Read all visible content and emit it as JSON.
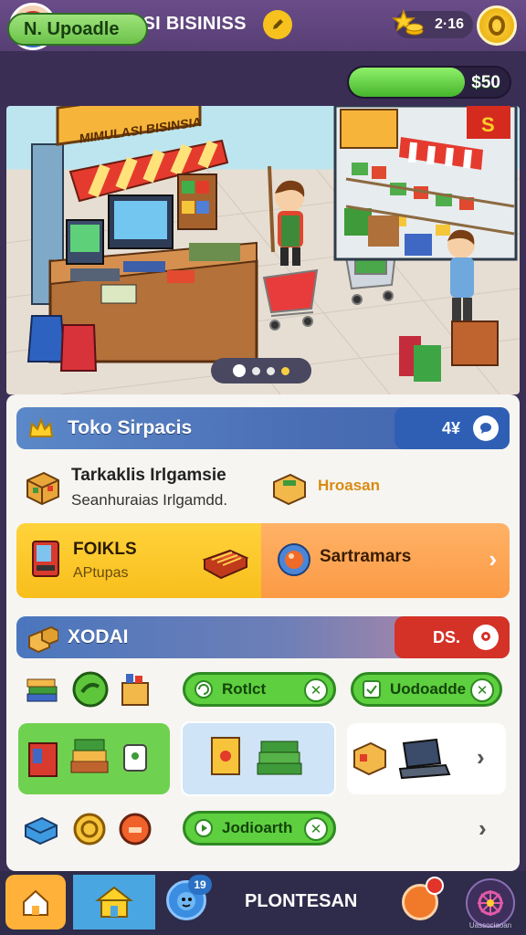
{
  "header": {
    "title": "SIMULASI BISINISS",
    "coins": "2·16",
    "avatar_icon": "player-avatar",
    "edit_icon": "pencil-icon",
    "gold_icon": "gold-coin-icon"
  },
  "status": {
    "level_label": "N. Upoadle",
    "money_label": "$50",
    "money_fill": 0.72
  },
  "scene": {
    "stall_sign": "MIMULASI BISINSIA",
    "shop_sign": "S",
    "pager_count": 4,
    "pager_active": 0
  },
  "shop_section": {
    "title": "Toko Sirpacis",
    "badge": "4¥",
    "info_title": "Tarkaklis Irlgamsie",
    "info_sub": "Seanhuraias Irlgamdd.",
    "info_side": "Hroasan",
    "card_left_title": "FOIKLS",
    "card_left_sub": "APtupas",
    "card_right_title": "Sartramars"
  },
  "inventory_section": {
    "title": "XODAI",
    "badge": "DS.",
    "chip1": "Rotlct",
    "chip2": "Uodoadde",
    "chip3": "Jodioarth"
  },
  "nav": {
    "badge_count": "19",
    "label": "PLONTESAN",
    "settings_caption": "Uassociaoan"
  },
  "colors": {
    "header": "#5d4379",
    "accent_green": "#5ecf3f",
    "accent_yellow": "#ffd33b",
    "accent_orange": "#fb9a45",
    "badge_red": "#d43127",
    "badge_blue": "#2f5fb5"
  }
}
